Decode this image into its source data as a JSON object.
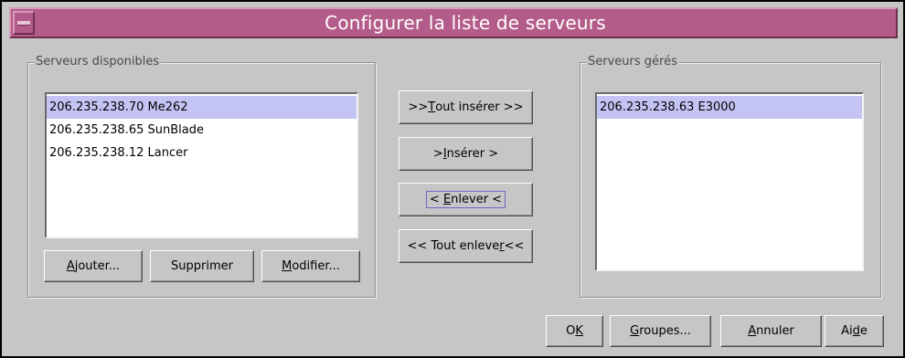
{
  "window": {
    "title": "Configurer la liste de serveurs"
  },
  "available": {
    "legend": "Serveurs disponibles",
    "items": [
      {
        "label": "206.235.238.70 Me262",
        "selected": true
      },
      {
        "label": "206.235.238.65 SunBlade",
        "selected": false
      },
      {
        "label": "206.235.238.12 Lancer",
        "selected": false
      }
    ],
    "add": {
      "pre": "",
      "mn": "A",
      "post": "jouter..."
    },
    "remove": {
      "pre": "Supprimer",
      "mn": "",
      "post": ""
    },
    "modify": {
      "pre": "",
      "mn": "M",
      "post": "odifier..."
    }
  },
  "transfer": {
    "insert_all": {
      "pre": ">> ",
      "mn": "T",
      "post": "out insérer >>"
    },
    "insert": {
      "pre": "> ",
      "mn": "I",
      "post": "nsérer >"
    },
    "remove": {
      "pre": "< ",
      "mn": "E",
      "post": "nlever <"
    },
    "remove_all": {
      "pre": "<< Tout enleve",
      "mn": "r",
      "post": " <<"
    }
  },
  "managed": {
    "legend": "Serveurs gérés",
    "items": [
      {
        "label": "206.235.238.63 E3000",
        "selected": true
      }
    ]
  },
  "footer": {
    "ok": {
      "pre": "O",
      "mn": "K",
      "post": ""
    },
    "groups": {
      "pre": "",
      "mn": "G",
      "post": "roupes..."
    },
    "cancel": {
      "pre": "",
      "mn": "A",
      "post": "nnuler"
    },
    "help": {
      "pre": "Ai",
      "mn": "d",
      "post": "e"
    }
  },
  "colors": {
    "title_bar": "#b45c89",
    "selection": "#c4c4f4",
    "background": "#c6c6c6"
  },
  "icons": {
    "window_menu": "window-menu-icon"
  }
}
